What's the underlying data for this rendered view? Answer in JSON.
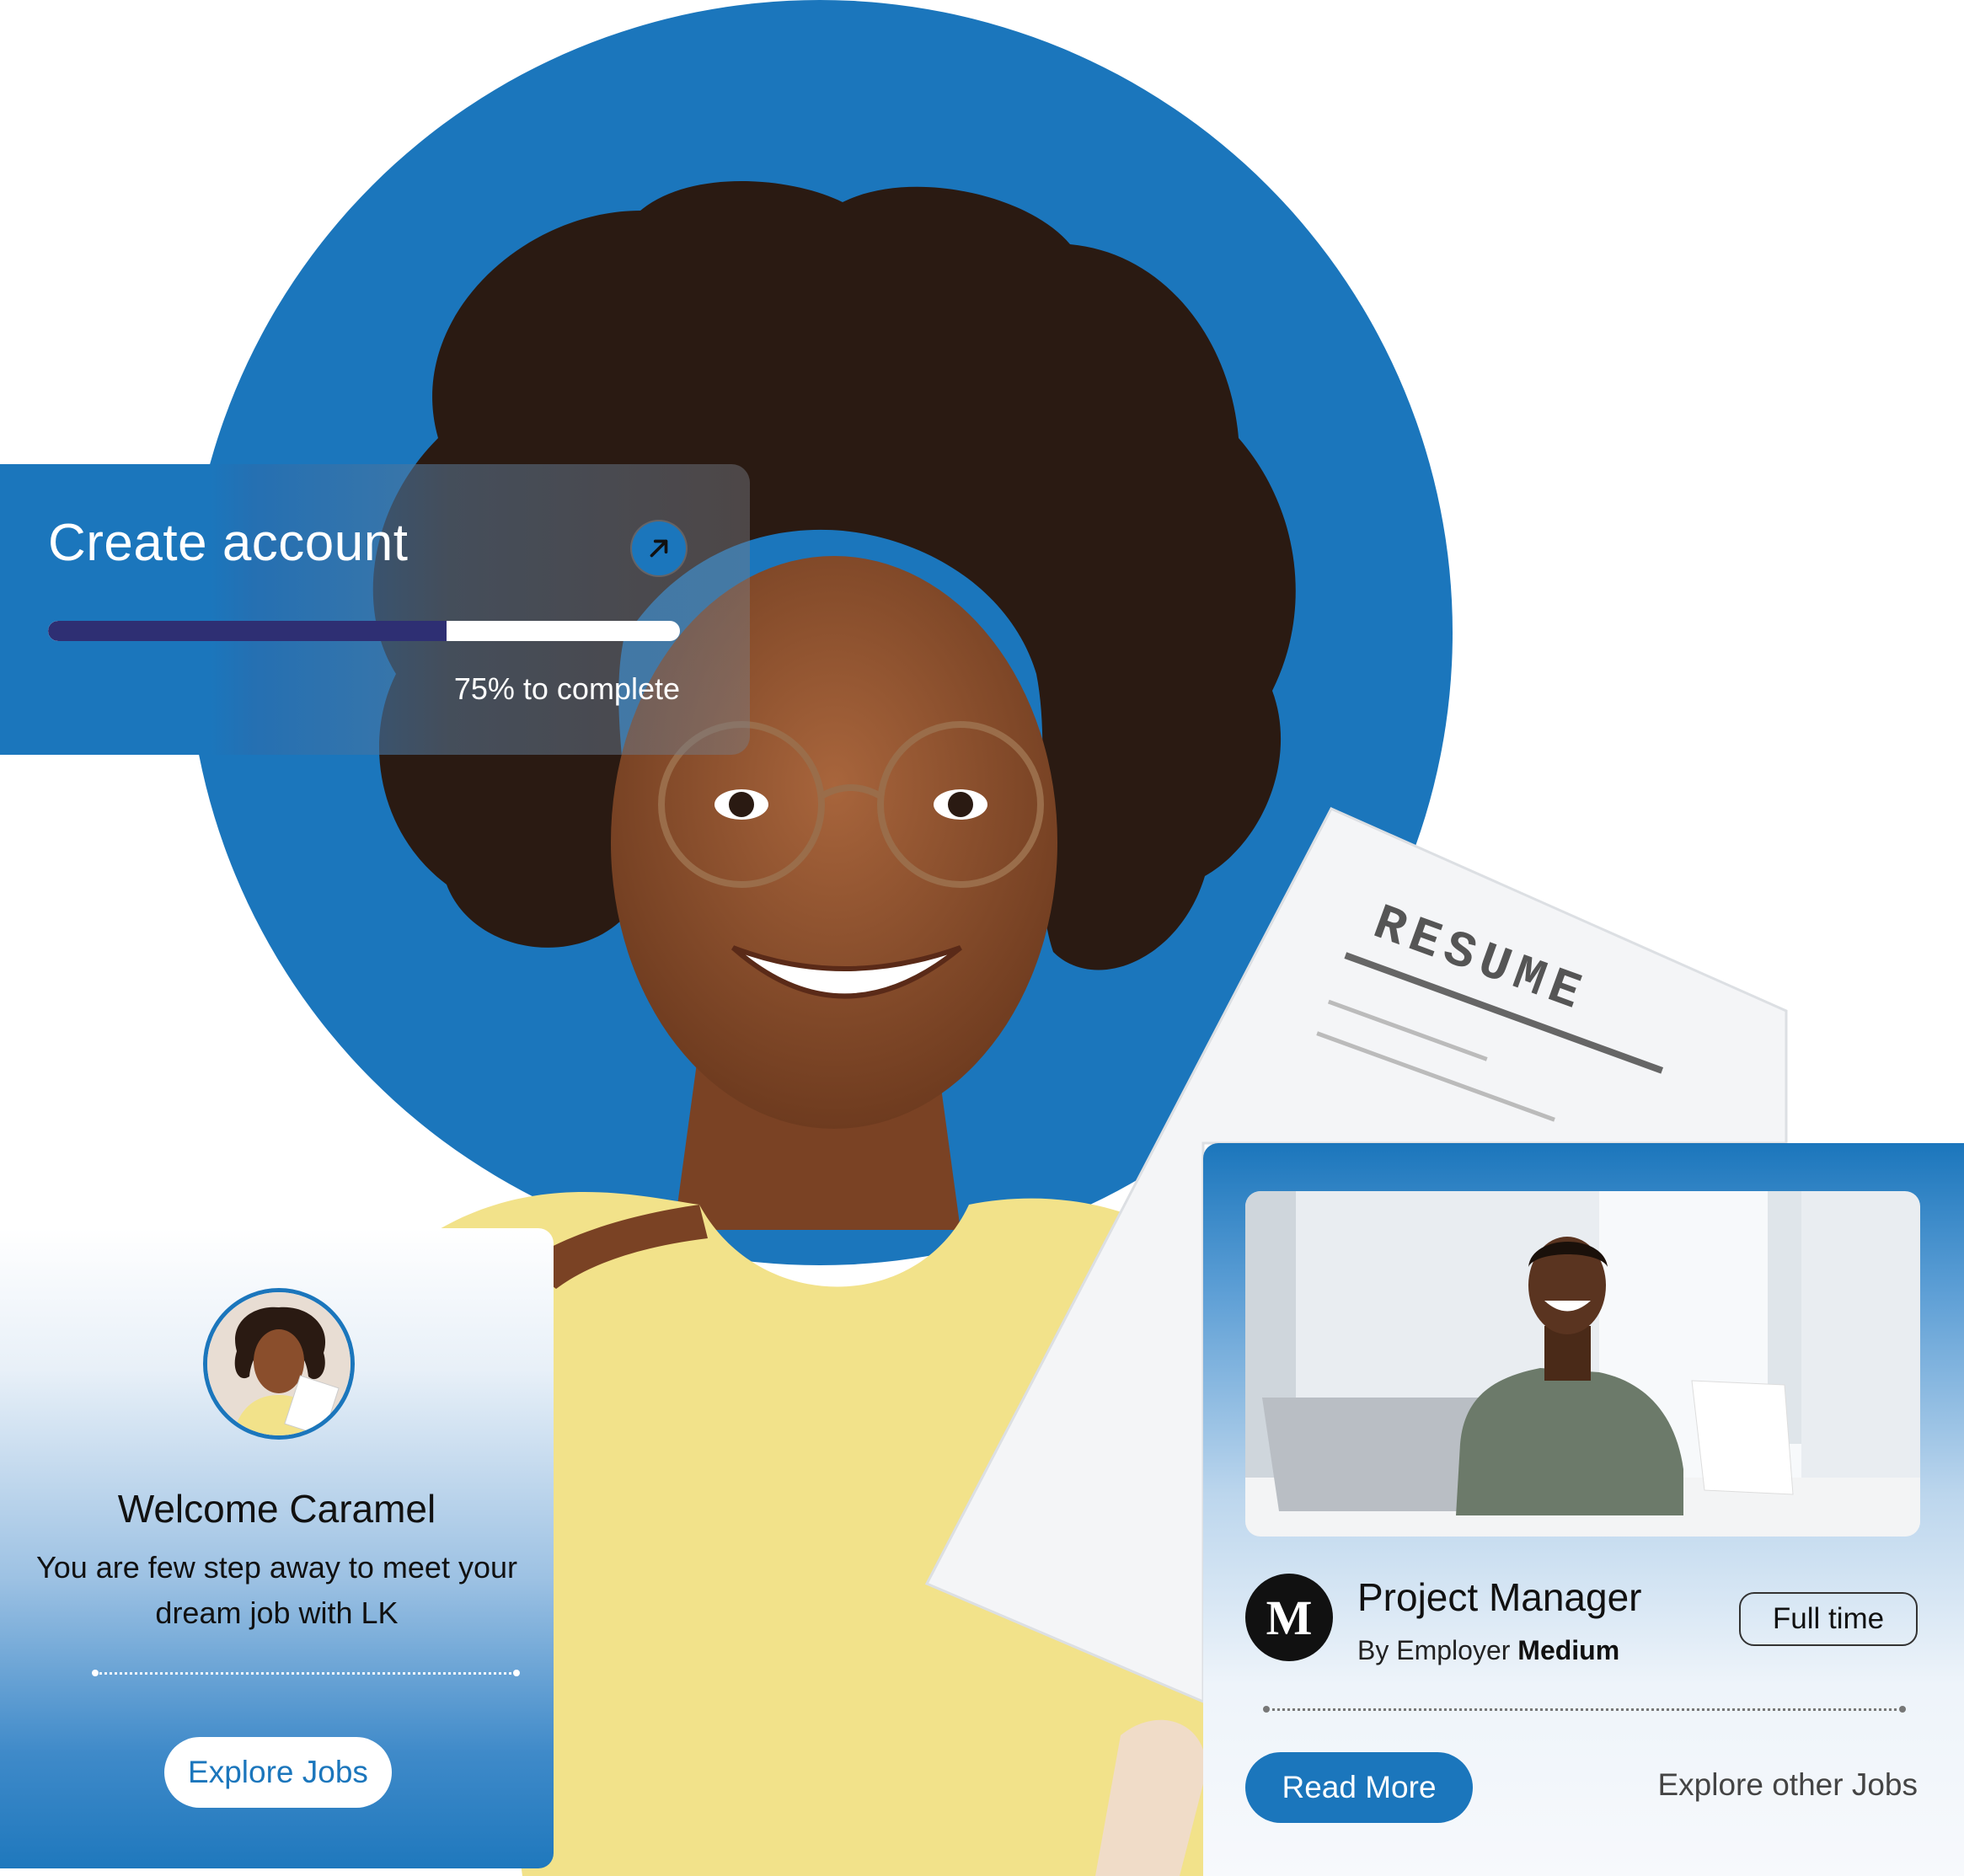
{
  "colors": {
    "primary": "#1b76bc",
    "progress_fill": "#2e2f73",
    "text_dark": "#111111"
  },
  "progress_card": {
    "title": "Create account",
    "arrow_icon": "arrow-up-right-icon",
    "progress_fraction": 0.63,
    "caption": "75% to complete"
  },
  "hero": {
    "resume_heading": "RESUME"
  },
  "welcome_card": {
    "title": "Welcome Caramel",
    "text": "You are few step away to meet your dream job with LK",
    "button": "Explore Jobs"
  },
  "job_card": {
    "logo_letter": "M",
    "title": "Project Manager",
    "employer_prefix": "By Employer",
    "employer_name": "Medium",
    "job_type": "Full time",
    "read_more": "Read More",
    "explore_other": "Explore other Jobs"
  }
}
